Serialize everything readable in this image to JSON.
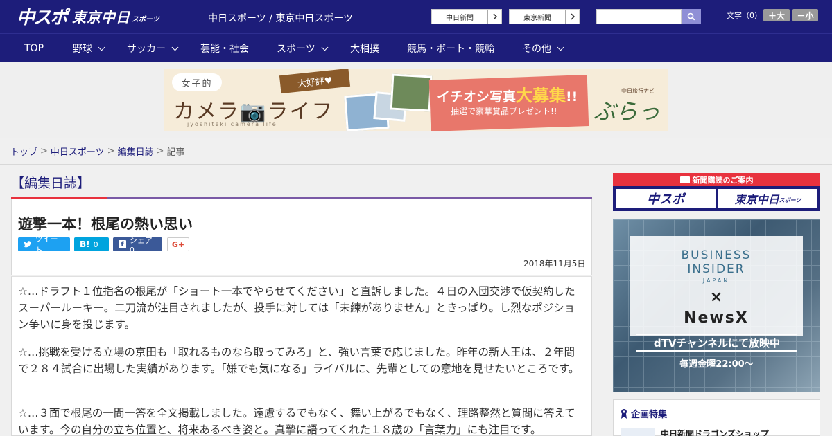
{
  "header": {
    "logo_main": "中スポ",
    "logo_sub": "東京中日",
    "logo_small": "スポーツ",
    "site_name": "中日スポーツ / 東京中日スポーツ",
    "link_chunichi": "中日新聞",
    "link_tokyo": "東京新聞",
    "search_placeholder": "",
    "font_label": "文字（0）",
    "font_bigger": "＋大",
    "font_smaller": "－小"
  },
  "nav": {
    "items": [
      {
        "label": "TOP"
      },
      {
        "label": "野球"
      },
      {
        "label": "サッカー"
      },
      {
        "label": "芸能・社会"
      },
      {
        "label": "スポーツ"
      },
      {
        "label": "大相撲"
      },
      {
        "label": "競馬・ボート・競輪"
      },
      {
        "label": "その他"
      }
    ]
  },
  "banner": {
    "joshi": "女子的",
    "title": "カメラ📷ライフ",
    "roman": "jyoshiteki camera life",
    "daikohyo": "大好評♥",
    "headline_a": "イチオシ写真",
    "headline_big": "大募集",
    "headline_b": "!!",
    "sub": "抽選で豪華賞品プレゼント!!",
    "navi": "中日旅行ナビ",
    "brand": "ぶらっ人"
  },
  "breadcrumb": {
    "items": [
      "トップ",
      "中日スポーツ",
      "編集日誌"
    ],
    "current": "記事"
  },
  "article": {
    "category": "【編集日誌】",
    "title": "遊撃一本！根尾の熱い思い",
    "share_tweet": "ツイート",
    "share_hatena_count": "0",
    "share_fb": "シェア 0",
    "date": "2018年11月5日",
    "paragraphs": [
      "☆…ドラフト１位指名の根尾が「ショート一本でやらせてください」と直訴しました。４日の入団交渉で仮契約したスーパールーキー。二刀流が注目されましたが、投手に対しては「未練がありません」ときっぱり。し烈なポジション争いに身を投じます。",
      "☆…挑戦を受ける立場の京田も「取れるものなら取ってみろ」と、強い言葉で応じました。昨年の新人王は、２年間で２８４試合に出場した実績があります。「嫌でも気になる」ライバルに、先輩としての意地を見せたいところです。",
      "☆…３面で根尾の一問一答を全文掲載しました。遠慮するでもなく、舞い上がるでもなく、理路整然と質問に答えています。今の自分の立ち位置と、将来あるべき姿と。真摯に語ってくれた１８歳の「言葉力」にも注目です。"
    ]
  },
  "sidebar": {
    "subscribe_head": "新聞購読のご案内",
    "subscribe_chuspo": "中スポ",
    "subscribe_tokyo": "東京中日",
    "subscribe_tokyo_small": "スポーツ",
    "ad_bi1": "BUSINESS",
    "ad_bi2": "INSIDER",
    "ad_japan": "JAPAN",
    "ad_x": "×",
    "ad_newsx": "NewsX",
    "ad_dtv": "dTVチャンネルにて放映中",
    "ad_week": "毎週金曜22:00〜",
    "feature_title": "企画特集",
    "feature_item": "中日新聞ドラゴンズショップ"
  },
  "colors": {
    "brand_navy": "#1d1d7a",
    "accent_red": "#e8323e",
    "accent_purple": "#7a5aa6",
    "twitter": "#1da1f2",
    "hatena": "#00a4de",
    "facebook": "#3b5998"
  }
}
